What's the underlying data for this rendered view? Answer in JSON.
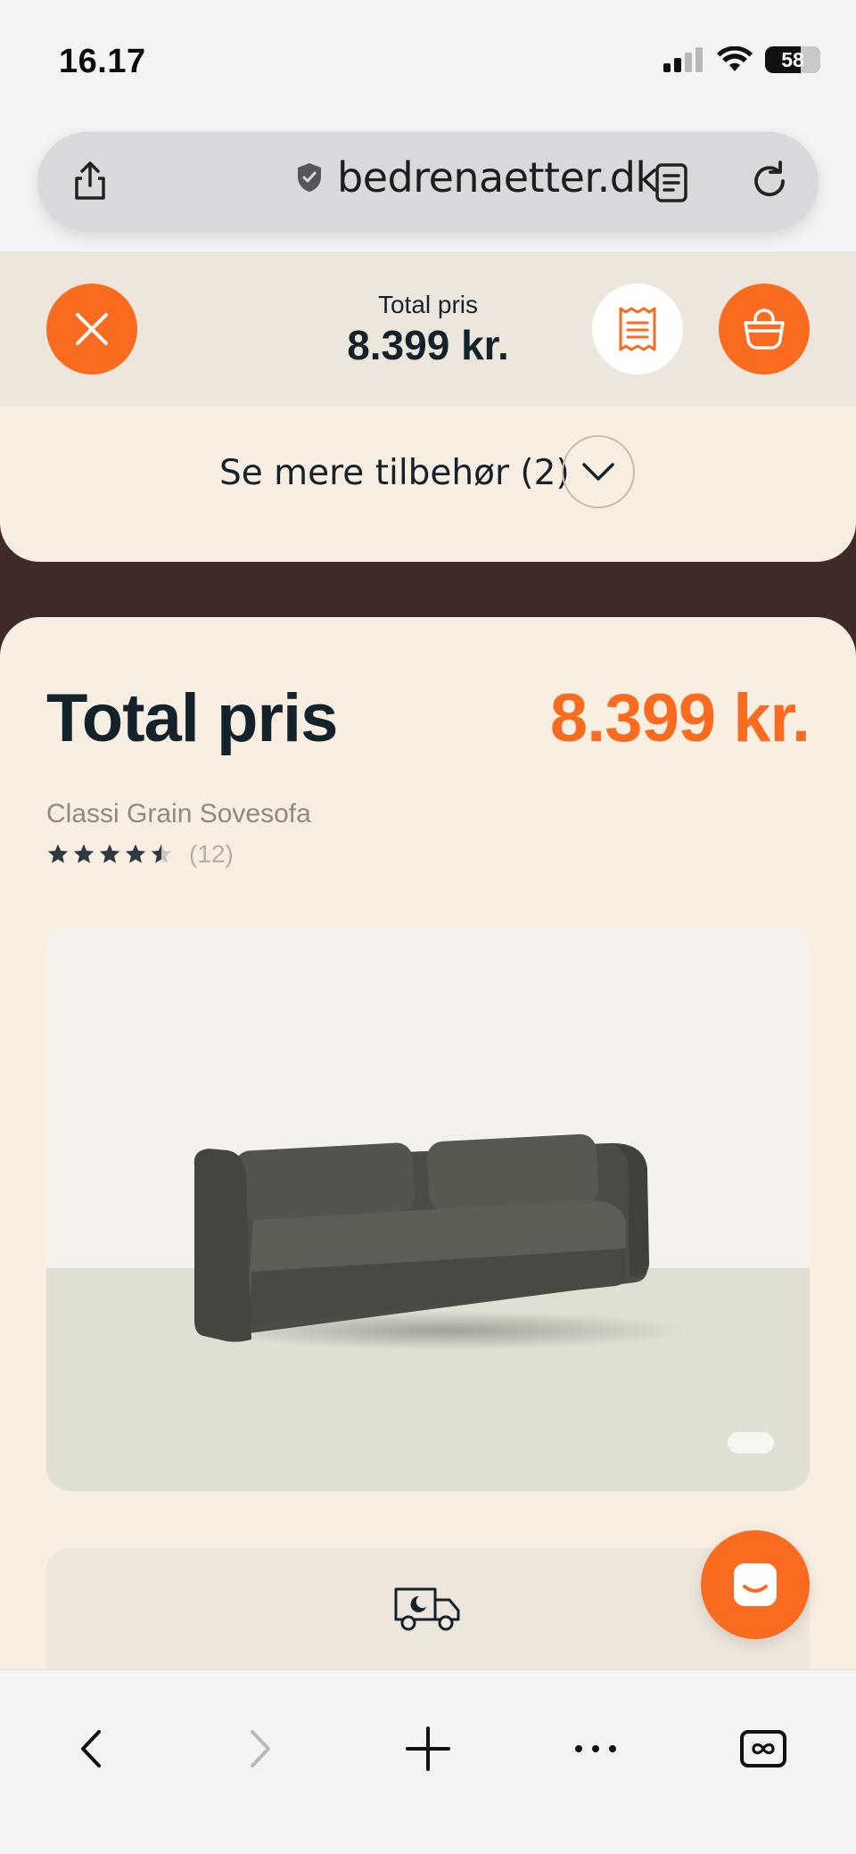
{
  "status_bar": {
    "time": "16.17",
    "battery": "58"
  },
  "browser": {
    "url": "bedrenaetter.dk"
  },
  "header": {
    "total_label": "Total pris",
    "total_value": "8.399 kr."
  },
  "accessories": {
    "label": "Se mere tilbehør (2)"
  },
  "summary": {
    "title": "Total pris",
    "price": "8.399 kr.",
    "product_name": "Classi Grain Sovesofa",
    "rating": 4.5,
    "rating_max": 5,
    "review_count": "(12)"
  },
  "colors": {
    "accent": "#f96b1e",
    "text_dark": "#14222b",
    "card_bg": "#f8eee2",
    "page_bg": "#3e2b28"
  },
  "icons": {
    "close": "close-icon",
    "receipt": "receipt-icon",
    "cart": "shopping-basket-icon",
    "chevron": "chevron-down-icon",
    "delivery": "delivery-truck-icon",
    "chat": "chat-icon"
  }
}
